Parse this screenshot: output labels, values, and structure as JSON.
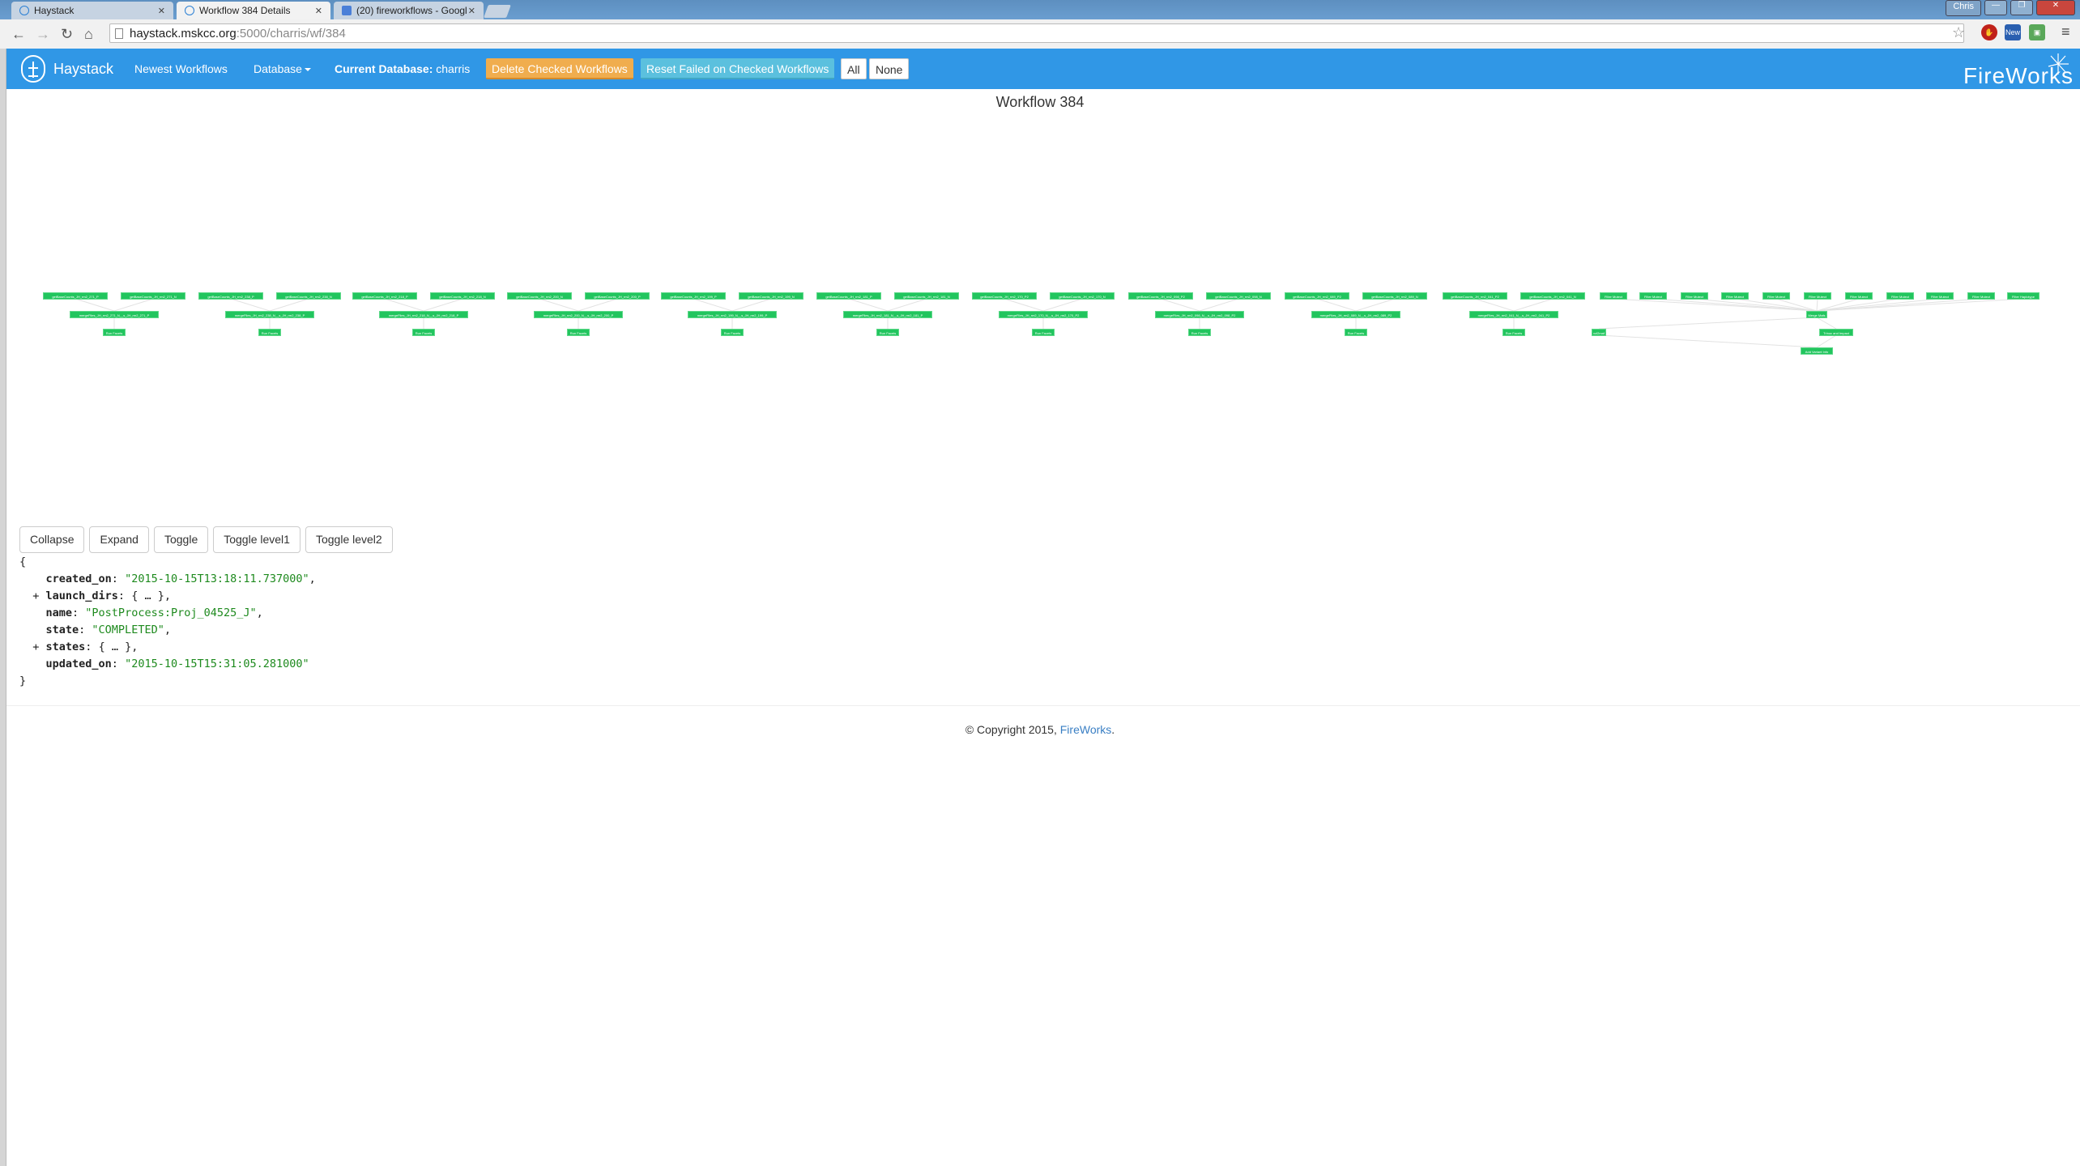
{
  "browser": {
    "tabs": [
      {
        "title": "Haystack",
        "active": false
      },
      {
        "title": "Workflow 384 Details",
        "active": true
      },
      {
        "title": "(20) fireworkflows - Googl",
        "active": false
      }
    ],
    "profile": "Chris",
    "url_host": "haystack.mskcc.org",
    "url_rest": ":5000/charris/wf/384",
    "ext_new_label": "New"
  },
  "navbar": {
    "brand": "Haystack",
    "newest_workflows": "Newest Workflows",
    "database": "Database",
    "current_db_label": "Current Database:",
    "current_db_value": "charris",
    "delete_checked": "Delete Checked Workflows",
    "reset_failed": "Reset Failed on Checked Workflows",
    "all": "All",
    "none": "None",
    "fireworks_logo": "FireWorks"
  },
  "page": {
    "title": "Workflow 384"
  },
  "graph": {
    "node_color": "#22c55e",
    "groups": [
      {
        "top": [
          "getBaseCounts_JH_rm2_271_P",
          "getBaseCounts_JH_rm2_271_N"
        ],
        "merge": "mergeFiles_JH_rm2_271_N__s_JH_rm2_271_P",
        "leaf": "Run Facets"
      },
      {
        "top": [
          "getBaseCounts_JH_rm2_238_P",
          "getBaseCounts_JH_rm2_238_N"
        ],
        "merge": "mergeFiles_JH_rm2_238_N__s_JH_rm2_238_P",
        "leaf": "Run Facets"
      },
      {
        "top": [
          "getBaseCounts_JH_rm2_218_P",
          "getBaseCounts_JH_rm2_218_N"
        ],
        "merge": "mergeFiles_JH_rm2_218_N__s_JH_rm2_218_P",
        "leaf": "Run Facets"
      },
      {
        "top": [
          "getBaseCounts_JH_rm2_200_N",
          "getBaseCounts_JH_rm2_200_P"
        ],
        "merge": "mergeFiles_JH_rm2_200_N__s_JH_rm2_200_P",
        "leaf": "Run Facets"
      },
      {
        "top": [
          "getBaseCounts_JH_rm2_199_P",
          "getBaseCounts_JH_rm2_199_N"
        ],
        "merge": "mergeFiles_JH_rm2_199_N__s_JH_rm2_199_P",
        "leaf": "Run Facets"
      },
      {
        "top": [
          "getBaseCounts_JH_rm2_181_P",
          "getBaseCounts_JH_rm2_181_N"
        ],
        "merge": "mergeFiles_JH_rm2_181_N__s_JH_rm2_181_P",
        "leaf": "Run Facets"
      },
      {
        "top": [
          "getBaseCounts_JH_rm2_170_P2",
          "getBaseCounts_JH_rm2_170_N"
        ],
        "merge": "mergeFiles_JH_rm2_170_N__s_JH_rm2_170_P2",
        "leaf": "Run Facets"
      },
      {
        "top": [
          "getBaseCounts_JH_rm2_098_P2",
          "getBaseCounts_JH_rm2_098_N"
        ],
        "merge": "mergeFiles_JH_rm2_098_N__s_JH_rm2_098_P2",
        "leaf": "Run Facets"
      },
      {
        "top": [
          "getBaseCounts_JH_rm2_089_P2",
          "getBaseCounts_JH_rm2_089_N"
        ],
        "merge": "mergeFiles_JH_rm2_089_N__s_JH_rm2_089_P2",
        "leaf": "Run Facets"
      },
      {
        "top": [
          "getBaseCounts_JH_rm2_041_P2",
          "getBaseCounts_JH_rm2_041_N"
        ],
        "merge": "mergeFiles_JH_rm2_041_N__s_JH_rm2_041_P2",
        "leaf": "Run Facets"
      }
    ],
    "filters": [
      "Filter Mutect",
      "Filter Mutect",
      "Filter Mutect",
      "Filter Mutect",
      "Filter Mutect",
      "Filter Mutect",
      "Filter Mutect",
      "Filter Mutect",
      "Filter Mutect",
      "Filter Mutect",
      "Filter Haplotype"
    ],
    "merge_mafs": "Merge Mafs",
    "vcf2maf": "vcf2maf",
    "trinuc": "Trinuc and Impact",
    "add_variant_info": "Add Variant Info"
  },
  "json_view": {
    "buttons": [
      "Collapse",
      "Expand",
      "Toggle",
      "Toggle level1",
      "Toggle level2"
    ],
    "open_brace": "{",
    "close_brace": "}",
    "rows": [
      {
        "toggle": "",
        "key": "created_on",
        "value": "\"2015-10-15T13:18:11.737000\"",
        "is_string": true
      },
      {
        "toggle": "+",
        "key": "launch_dirs",
        "value": "{ … }",
        "is_string": false
      },
      {
        "toggle": "",
        "key": "name",
        "value": "\"PostProcess:Proj_04525_J\"",
        "is_string": true
      },
      {
        "toggle": "",
        "key": "state",
        "value": "\"COMPLETED\"",
        "is_string": true
      },
      {
        "toggle": "+",
        "key": "states",
        "value": "{ … }",
        "is_string": false
      },
      {
        "toggle": "",
        "key": "updated_on",
        "value": "\"2015-10-15T15:31:05.281000\"",
        "is_string": true,
        "last": true
      }
    ]
  },
  "footer": {
    "copyright": "© Copyright 2015, ",
    "link": "FireWorks",
    "suffix": "."
  }
}
